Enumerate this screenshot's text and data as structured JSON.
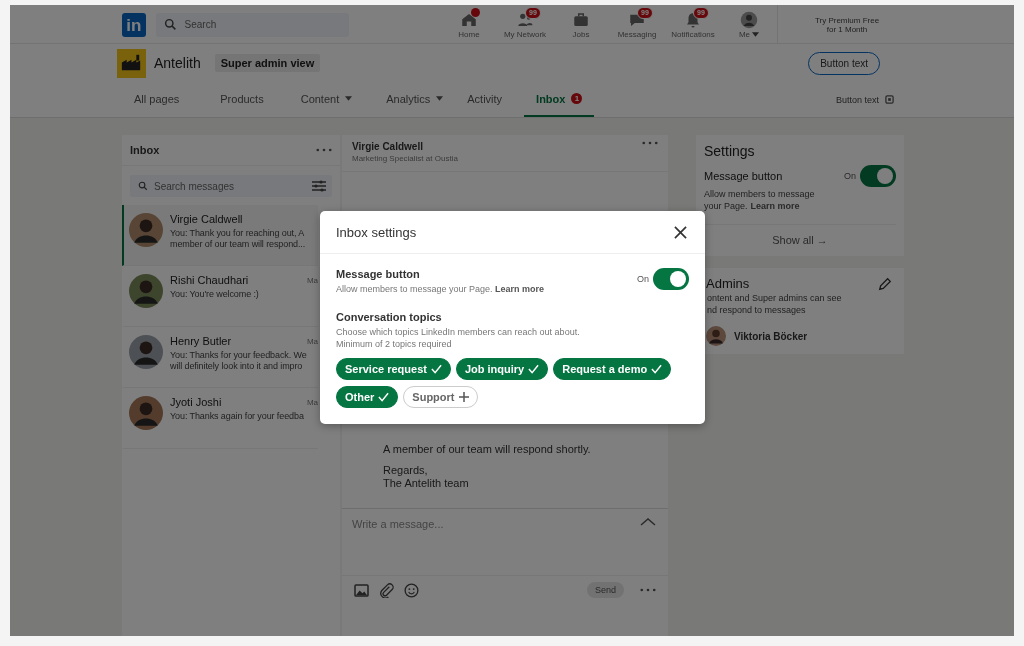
{
  "nav": {
    "logo": "in",
    "search_placeholder": "Search",
    "items": [
      {
        "label": "Home",
        "dot": true,
        "caret": false
      },
      {
        "label": "My Network",
        "badge": "99",
        "dot": false,
        "caret": false
      },
      {
        "label": "Jobs",
        "dot": false,
        "caret": false
      },
      {
        "label": "Messaging",
        "badge": "99",
        "dot": false,
        "caret": false
      },
      {
        "label": "Notifications",
        "badge": "99",
        "dot": false,
        "caret": false
      },
      {
        "label": "Me",
        "dot": false,
        "caret": true
      }
    ],
    "premium": [
      "Try Premium Free",
      "for 1 Month"
    ]
  },
  "page_header": {
    "name": "Antelith",
    "role_badge": "Super admin view",
    "button": "Button text"
  },
  "tabs": [
    {
      "label": "All pages",
      "selected": false,
      "dropdown": false
    },
    {
      "label": "Products",
      "selected": false,
      "dropdown": false
    },
    {
      "label": "Content",
      "selected": false,
      "dropdown": true
    },
    {
      "label": "Analytics",
      "selected": false,
      "dropdown": true
    },
    {
      "label": "Activity",
      "selected": false,
      "dropdown": false
    },
    {
      "label": "Inbox",
      "selected": true,
      "dropdown": false,
      "badge": "1"
    }
  ],
  "tabs_action": "Button text",
  "inbox": {
    "title": "Inbox",
    "search_placeholder": "Search messages",
    "conversations": [
      {
        "name": "Virgie Caldwell",
        "preview": [
          "You: Thank you for reaching out, A",
          "member of our team will respond..."
        ],
        "selected": true
      },
      {
        "name": "Rishi Chaudhari",
        "date": "Ma",
        "preview": [
          "You: You're welcome :)"
        ],
        "selected": false
      },
      {
        "name": "Henry Butler",
        "date": "Ma",
        "preview": [
          "You: Thanks for your feedback. We",
          "will definitely look into it and impro"
        ],
        "selected": false
      },
      {
        "name": "Jyoti Joshi",
        "date": "Ma",
        "preview": [
          "You: Thanks again for your feedba"
        ],
        "selected": false
      }
    ]
  },
  "conversation": {
    "name": "Virgie Caldwell",
    "headline": "Marketing Specialist at Oustia",
    "message_paragraphs": [
      [
        "A member of our team will respond shortly."
      ],
      [
        "Regards,",
        "The Antelith team"
      ]
    ],
    "composer_placeholder": "Write a message...",
    "send": {
      "label": "Send",
      "disabled": true
    }
  },
  "settings_card": {
    "title": "Settings",
    "label": "Message button",
    "description": [
      "Allow members to message",
      "your Page."
    ],
    "link": "Learn more",
    "state_label": "On",
    "on": true,
    "show_all": "Show all →"
  },
  "admins_card": {
    "title": "Admins",
    "description": [
      "ontent and Super admins can see",
      "nd respond to messages"
    ],
    "admins": [
      {
        "name": "Viktoria Böcker"
      }
    ]
  },
  "modal": {
    "title": "Inbox settings",
    "label": "Message button",
    "description": "Allow members to message your Page.",
    "link": "Learn more",
    "state_label": "On",
    "on": true,
    "topics_title": "Conversation topics",
    "topics_description": [
      "Choose which topics LinkedIn members can reach out about.",
      "Minimum of 2 topics required"
    ],
    "topics": [
      {
        "label": "Service request",
        "selected": true
      },
      {
        "label": "Job inquiry",
        "selected": true
      },
      {
        "label": "Request a demo",
        "selected": true
      },
      {
        "label": "Other",
        "selected": true
      },
      {
        "label": "Support",
        "selected": false
      }
    ]
  }
}
